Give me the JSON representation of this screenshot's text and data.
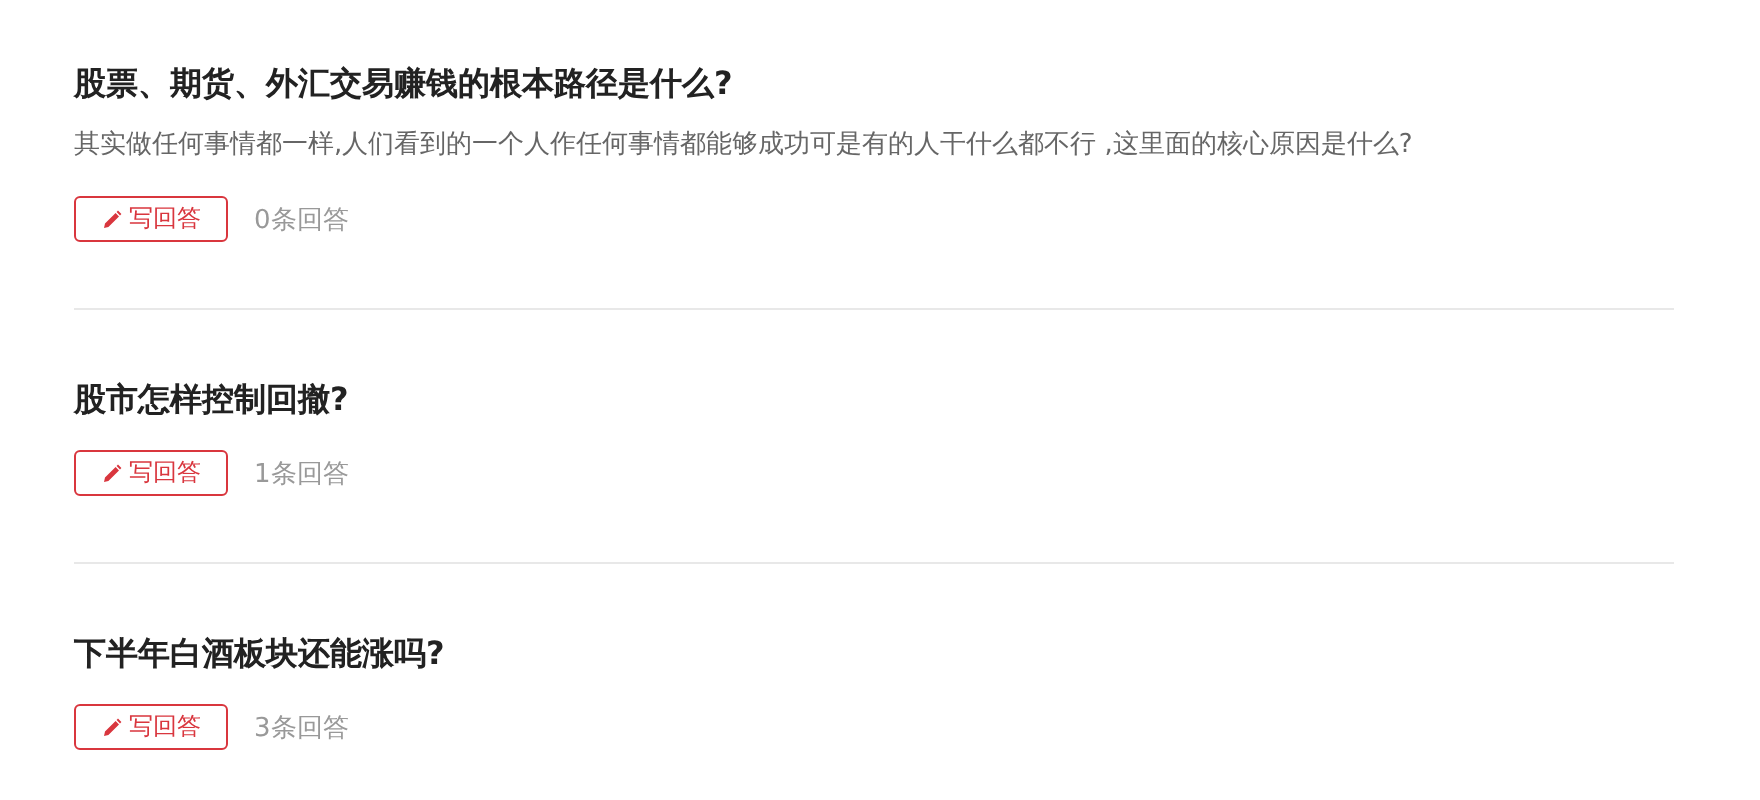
{
  "questions": [
    {
      "title": "股票、期货、外汇交易赚钱的根本路径是什么?",
      "description": "其实做任何事情都一样,人们看到的一个人作任何事情都能够成功可是有的人干什么都不行 ,这里面的核心原因是什么?",
      "answer_button": "写回答",
      "answer_count": "0条回答"
    },
    {
      "title": "股市怎样控制回撤?",
      "answer_button": "写回答",
      "answer_count": "1条回答"
    },
    {
      "title": "下半年白酒板块还能涨吗?",
      "answer_button": "写回答",
      "answer_count": "3条回答"
    }
  ]
}
